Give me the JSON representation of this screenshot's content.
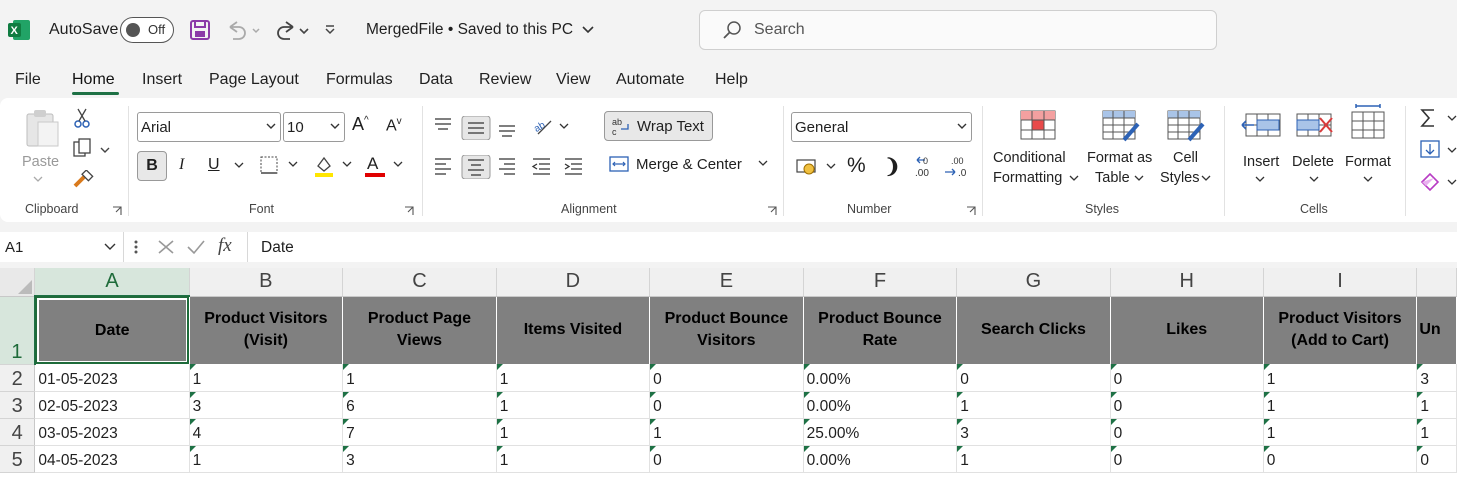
{
  "titlebar": {
    "autosave_label": "AutoSave",
    "autosave_state": "Off",
    "file_title": "MergedFile • Saved to this PC",
    "search_placeholder": "Search"
  },
  "menu": [
    "File",
    "Home",
    "Insert",
    "Page Layout",
    "Formulas",
    "Data",
    "Review",
    "View",
    "Automate",
    "Help"
  ],
  "active_tab": "Home",
  "ribbon": {
    "clipboard": {
      "paste": "Paste",
      "label": "Clipboard"
    },
    "font": {
      "name": "Arial",
      "size": "10",
      "label": "Font",
      "bold": "B",
      "italic": "I",
      "underline": "U"
    },
    "alignment": {
      "wrap": "Wrap Text",
      "merge": "Merge & Center",
      "label": "Alignment"
    },
    "number": {
      "format": "General",
      "label": "Number",
      "percent": "%",
      "comma": "❩"
    },
    "styles": {
      "conditional_1": "Conditional",
      "conditional_2": "Formatting",
      "table_1": "Format as",
      "table_2": "Table",
      "cell_1": "Cell",
      "cell_2": "Styles",
      "label": "Styles"
    },
    "cells": {
      "insert": "Insert",
      "delete": "Delete",
      "format": "Format",
      "label": "Cells"
    }
  },
  "formula_bar": {
    "name_box": "A1",
    "fx": "fx",
    "content": "Date"
  },
  "colors": {
    "accent": "#1e7145",
    "header_fill": "#808080"
  },
  "sheet": {
    "columns": [
      "A",
      "B",
      "C",
      "D",
      "E",
      "F",
      "G",
      "H",
      "I"
    ],
    "row_numbers": [
      "1",
      "2",
      "3",
      "4",
      "5"
    ],
    "headers": [
      "Date",
      "Product Visitors (Visit)",
      "Product Page Views",
      "Items Visited",
      "Product Bounce Visitors",
      "Product Bounce Rate",
      "Search Clicks",
      "Likes",
      "Product Visitors (Add to Cart)",
      "Un"
    ],
    "rows": [
      [
        "01-05-2023",
        "1",
        "1",
        "1",
        "0",
        "0.00%",
        "0",
        "0",
        "1",
        "3"
      ],
      [
        "02-05-2023",
        "3",
        "6",
        "1",
        "0",
        "0.00%",
        "1",
        "0",
        "1",
        "1"
      ],
      [
        "03-05-2023",
        "4",
        "7",
        "1",
        "1",
        "25.00%",
        "3",
        "0",
        "1",
        "1"
      ],
      [
        "04-05-2023",
        "1",
        "3",
        "1",
        "0",
        "0.00%",
        "1",
        "0",
        "0",
        "0"
      ]
    ]
  }
}
